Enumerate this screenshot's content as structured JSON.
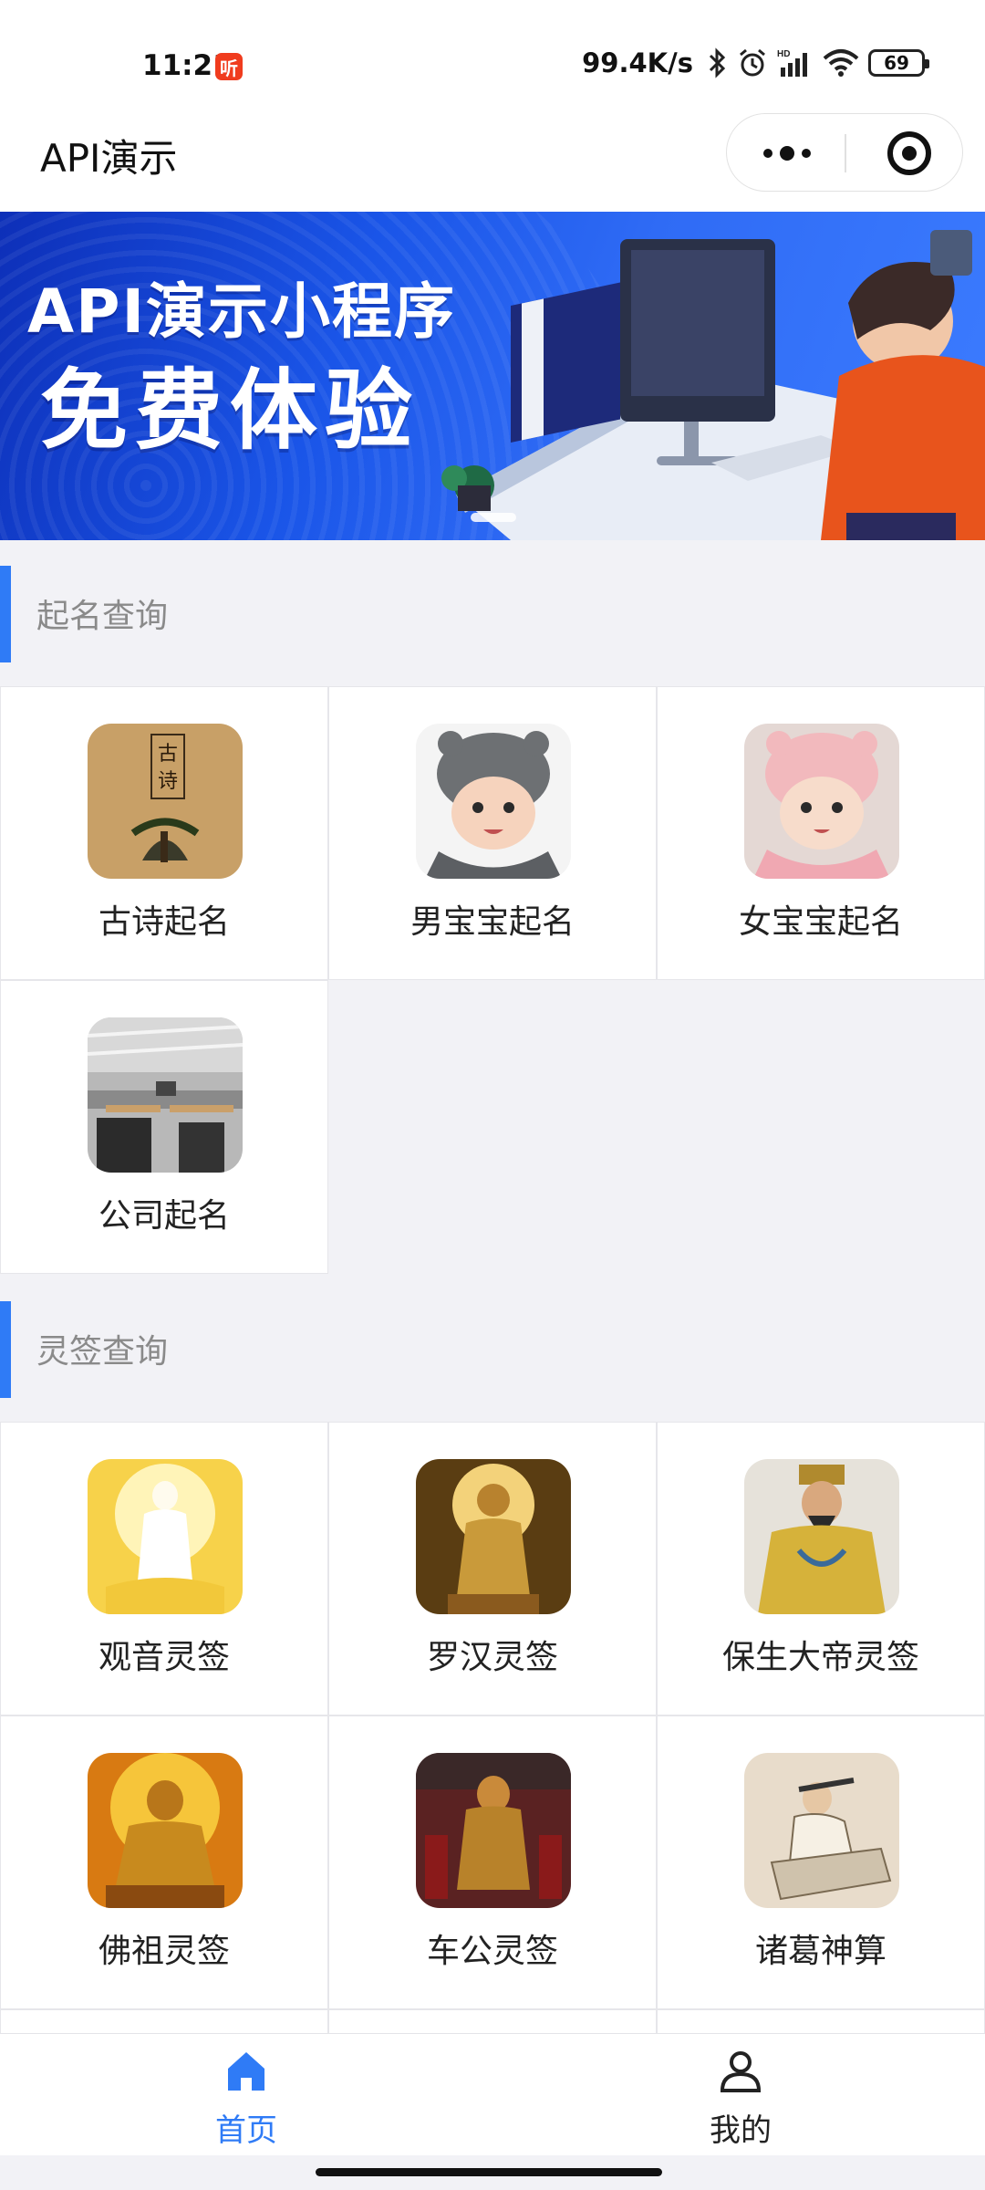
{
  "status_bar": {
    "time": "11:21",
    "app_badge": "听",
    "network_speed": "99.4K/s",
    "battery": "69"
  },
  "header": {
    "title": "API演示"
  },
  "banner": {
    "line1": "API演示小程序",
    "line2": "免费体验"
  },
  "sections": [
    {
      "title": "起名查询",
      "items": [
        {
          "label": "古诗起名",
          "icon": "ancient-poetry-book-icon"
        },
        {
          "label": "男宝宝起名",
          "icon": "baby-boy-icon"
        },
        {
          "label": "女宝宝起名",
          "icon": "baby-girl-icon"
        },
        {
          "label": "公司起名",
          "icon": "office-icon"
        }
      ]
    },
    {
      "title": "灵签查询",
      "items": [
        {
          "label": "观音灵签",
          "icon": "guanyin-icon"
        },
        {
          "label": "罗汉灵签",
          "icon": "arhat-icon"
        },
        {
          "label": "保生大帝灵签",
          "icon": "baosheng-emperor-icon"
        },
        {
          "label": "佛祖灵签",
          "icon": "buddha-icon"
        },
        {
          "label": "车公灵签",
          "icon": "chegong-icon"
        },
        {
          "label": "诸葛神算",
          "icon": "zhuge-icon"
        }
      ]
    }
  ],
  "tabs": [
    {
      "label": "首页",
      "active": true,
      "icon": "home-icon"
    },
    {
      "label": "我的",
      "active": false,
      "icon": "user-icon"
    }
  ],
  "colors": {
    "accent": "#2f7bf6",
    "background": "#f2f2f6",
    "section_title": "#8a8a8a"
  }
}
